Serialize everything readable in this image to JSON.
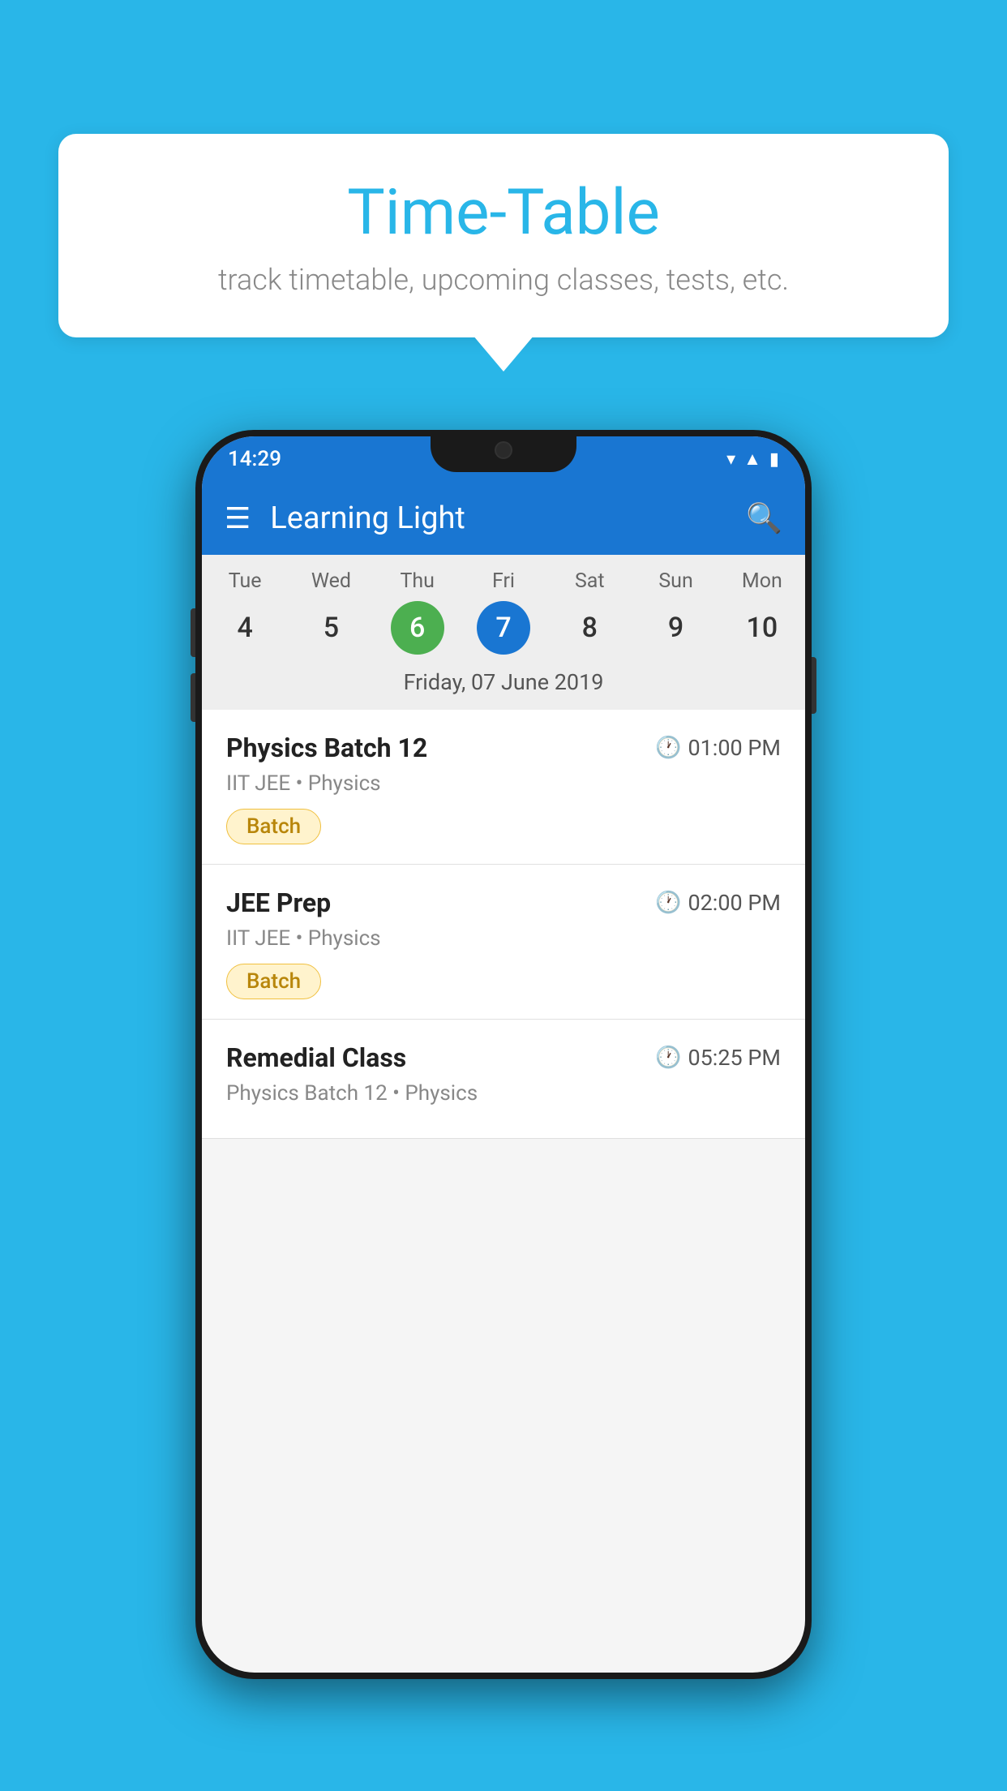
{
  "background_color": "#29B6E8",
  "bubble": {
    "title": "Time-Table",
    "subtitle": "track timetable, upcoming classes, tests, etc."
  },
  "phone": {
    "status_bar": {
      "time": "14:29"
    },
    "app_bar": {
      "title": "Learning Light"
    },
    "calendar": {
      "days": [
        {
          "name": "Tue",
          "number": "4",
          "state": "normal"
        },
        {
          "name": "Wed",
          "number": "5",
          "state": "normal"
        },
        {
          "name": "Thu",
          "number": "6",
          "state": "today"
        },
        {
          "name": "Fri",
          "number": "7",
          "state": "selected"
        },
        {
          "name": "Sat",
          "number": "8",
          "state": "normal"
        },
        {
          "name": "Sun",
          "number": "9",
          "state": "normal"
        },
        {
          "name": "Mon",
          "number": "10",
          "state": "normal"
        }
      ],
      "selected_date_label": "Friday, 07 June 2019"
    },
    "classes": [
      {
        "name": "Physics Batch 12",
        "time": "01:00 PM",
        "meta": "IIT JEE • Physics",
        "tag": "Batch"
      },
      {
        "name": "JEE Prep",
        "time": "02:00 PM",
        "meta": "IIT JEE • Physics",
        "tag": "Batch"
      },
      {
        "name": "Remedial Class",
        "time": "05:25 PM",
        "meta": "Physics Batch 12 • Physics",
        "tag": null
      }
    ]
  }
}
